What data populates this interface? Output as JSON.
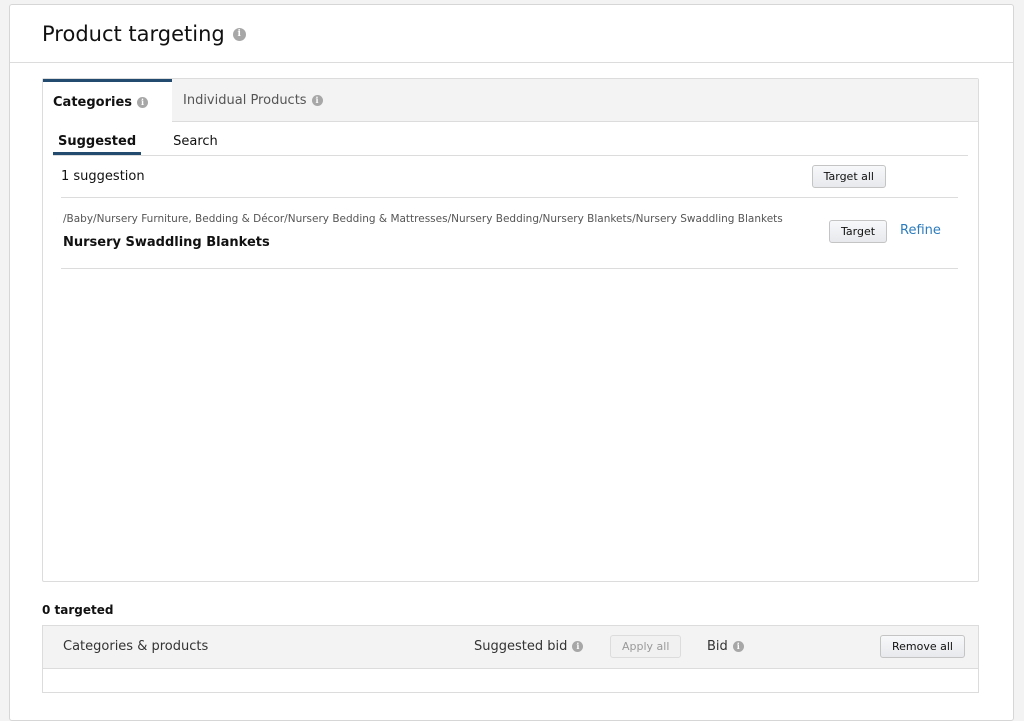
{
  "panel": {
    "title": "Product targeting"
  },
  "tabs": [
    {
      "label": "Categories",
      "active": true
    },
    {
      "label": "Individual Products",
      "active": false
    }
  ],
  "subtabs": [
    {
      "label": "Suggested",
      "active": true
    },
    {
      "label": "Search",
      "active": false
    }
  ],
  "suggestions": {
    "count_text": "1 suggestion",
    "target_all_label": "Target all",
    "items": [
      {
        "path": "/Baby/Nursery Furniture, Bedding & Décor/Nursery Bedding & Mattresses/Nursery Bedding/Nursery Blankets/Nursery Swaddling Blankets",
        "name": "Nursery Swaddling Blankets",
        "target_label": "Target",
        "refine_label": "Refine"
      }
    ]
  },
  "targeted": {
    "count_text": "0 targeted",
    "columns": {
      "categories": "Categories & products",
      "suggested_bid": "Suggested bid",
      "apply_all": "Apply all",
      "bid": "Bid",
      "remove_all": "Remove all"
    }
  },
  "icons": {
    "info": "info-icon"
  },
  "colors": {
    "accent": "#234a6f",
    "link": "#2c7cbd"
  }
}
